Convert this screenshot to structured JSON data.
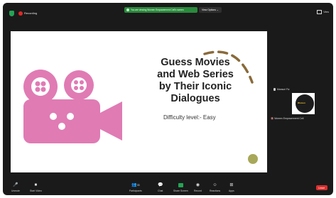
{
  "top_bar": {
    "recording_label": "Recording",
    "share_banner": "You are viewing Women Empowerment Cell's screen",
    "view_options": "View Options ⌄",
    "view_button": "View"
  },
  "slide": {
    "title_lines": [
      "Guess Movies",
      "and Web Series",
      "by Their Iconic",
      "Dialogues"
    ],
    "subtitle": "Difficulty level:- Easy",
    "accent_color": "#e07bb4",
    "arc_color": "#8a6a3a",
    "circle_color": "#a8a85a"
  },
  "side_panel": {
    "participant_name": "Mansuri Fiz",
    "thumbnail_logo_text": "Women",
    "thumbnail_caption_prefix": "🔇",
    "thumbnail_caption": "Women Empowerment Cell"
  },
  "toolbar": {
    "unmute": "Unmute",
    "start_video": "Start Video",
    "participants": "Participants",
    "participants_count": "33",
    "chat": "Chat",
    "share_screen": "Share Screen",
    "record": "Record",
    "reactions": "Reactions",
    "apps": "Apps",
    "leave": "Leave"
  }
}
